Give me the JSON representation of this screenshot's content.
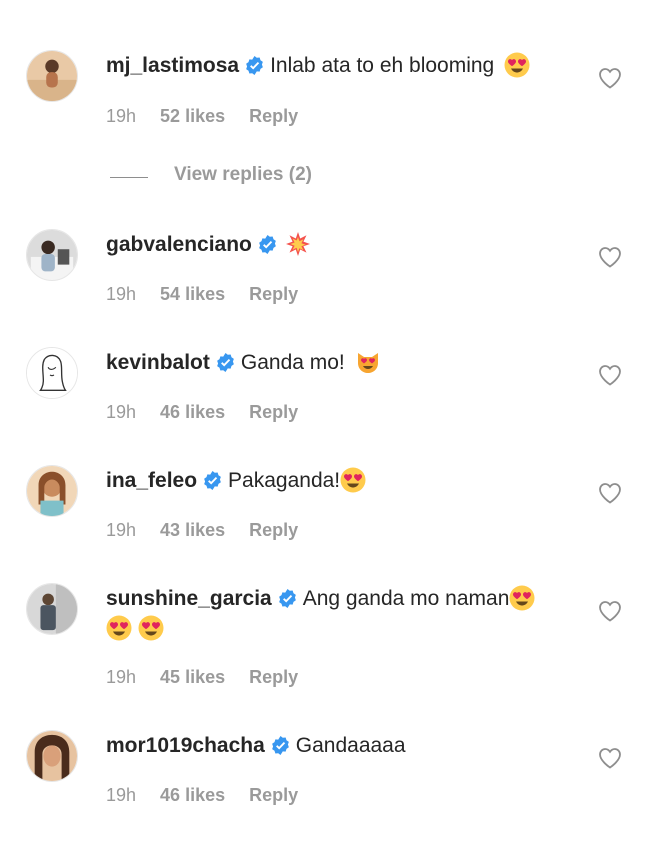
{
  "colors": {
    "verified": "#3897f0",
    "meta_text": "#9a9a9a",
    "primary_text": "#262626"
  },
  "view_replies": {
    "label": "View replies (2)"
  },
  "comments": [
    {
      "username": "mj_lastimosa",
      "text": "Inlab ata to eh blooming",
      "emoji": "heart-eyes",
      "time": "19h",
      "likes": "52 likes",
      "reply": "Reply"
    },
    {
      "username": "gabvalenciano",
      "text": "",
      "emoji": "collision",
      "time": "19h",
      "likes": "54 likes",
      "reply": "Reply"
    },
    {
      "username": "kevinbalot",
      "text": "Ganda mo!",
      "emoji": "heart-eyes-cat",
      "time": "19h",
      "likes": "46 likes",
      "reply": "Reply"
    },
    {
      "username": "ina_feleo",
      "text": "Pakaganda!",
      "emoji": "heart-eyes",
      "time": "19h",
      "likes": "43 likes",
      "reply": "Reply"
    },
    {
      "username": "sunshine_garcia",
      "text": "Ang ganda mo naman",
      "emoji": "heart-eyes",
      "extra_emojis": [
        "heart-eyes",
        "heart-eyes"
      ],
      "time": "19h",
      "likes": "45 likes",
      "reply": "Reply"
    },
    {
      "username": "mor1019chacha",
      "text": "Gandaaaaa",
      "emoji": "",
      "time": "19h",
      "likes": "46 likes",
      "reply": "Reply"
    }
  ]
}
